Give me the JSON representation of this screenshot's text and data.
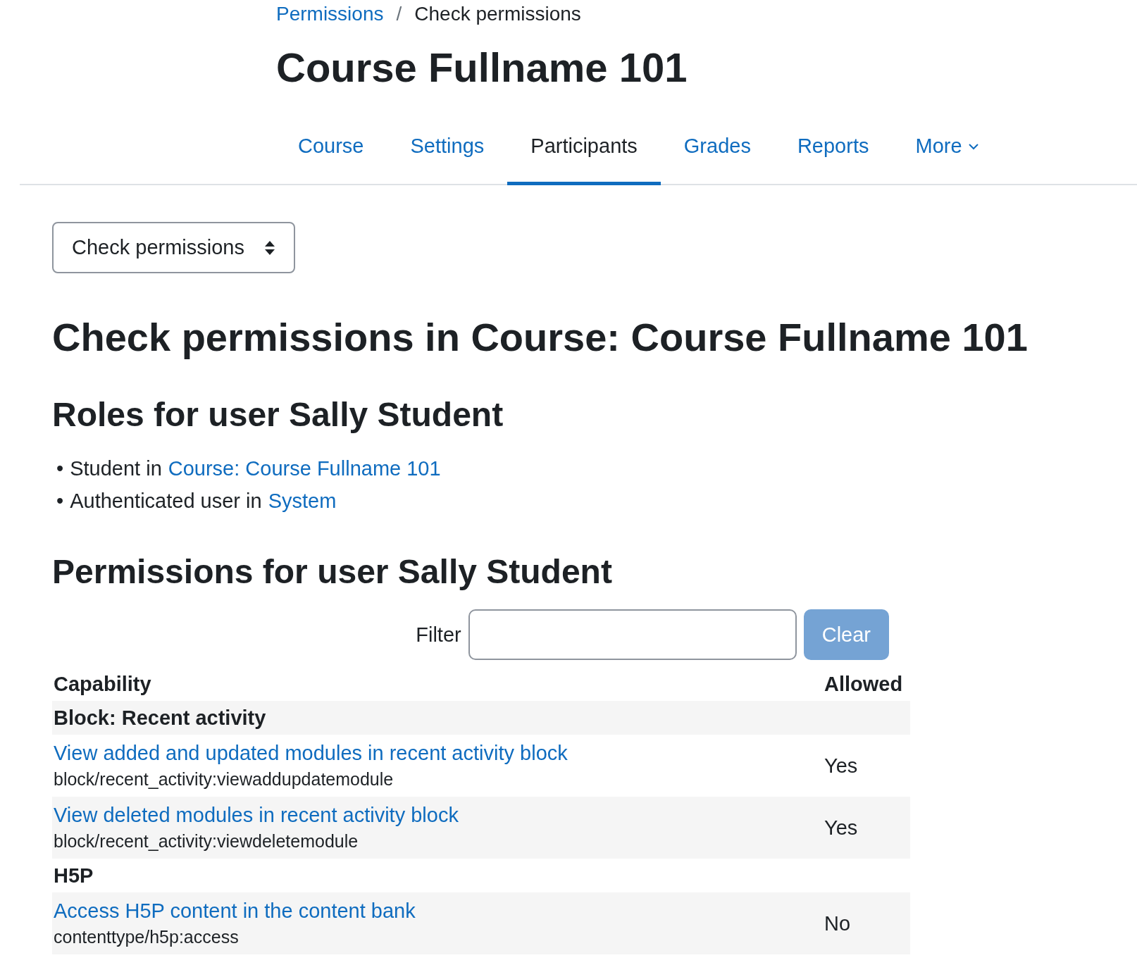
{
  "breadcrumb": [
    {
      "label": "Permissions",
      "link": true
    },
    {
      "label": "Check permissions",
      "link": false
    }
  ],
  "breadcrumb_separator": "/",
  "course_title": "Course Fullname 101",
  "tabs": [
    {
      "label": "Course",
      "selected": false
    },
    {
      "label": "Settings",
      "selected": false
    },
    {
      "label": "Participants",
      "selected": true
    },
    {
      "label": "Grades",
      "selected": false
    },
    {
      "label": "Reports",
      "selected": false
    },
    {
      "label": "More",
      "selected": false,
      "dropdown": true
    }
  ],
  "page_select": {
    "value": "Check permissions"
  },
  "heading": "Check permissions in Course: Course Fullname 101",
  "roles_heading": "Roles for user Sally Student",
  "roles": [
    {
      "bullet": "•",
      "text": "Student in",
      "link": "Course: Course Fullname 101"
    },
    {
      "bullet": "•",
      "text": "Authenticated user in",
      "link": "System"
    }
  ],
  "permissions_heading": "Permissions for user Sally Student",
  "filter": {
    "label": "Filter",
    "clear_button": "Clear",
    "clear_disabled": true
  },
  "table": {
    "columns": [
      "Capability",
      "Allowed"
    ],
    "rows": [
      {
        "kind": "category",
        "name": "Block: Recent activity"
      },
      {
        "kind": "capability",
        "name": "View added and updated modules in recent activity block",
        "code": "block/recent_activity:viewaddupdatemodule",
        "allowed": "Yes"
      },
      {
        "kind": "capability",
        "name": "View deleted modules in recent activity block",
        "code": "block/recent_activity:viewdeletemodule",
        "allowed": "Yes"
      },
      {
        "kind": "category",
        "name": "H5P"
      },
      {
        "kind": "capability",
        "name": "Access H5P content in the content bank",
        "code": "contenttype/h5p:access",
        "allowed": "No"
      }
    ]
  }
}
